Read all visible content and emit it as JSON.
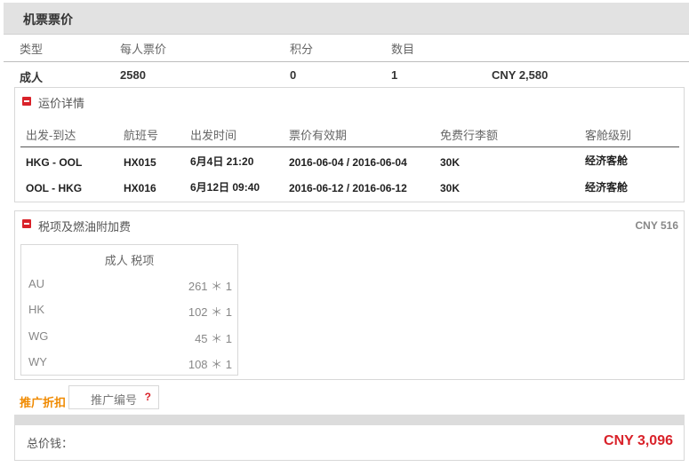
{
  "title": "机票票价",
  "summary": {
    "headers": [
      "类型",
      "每人票价",
      "积分",
      "数目"
    ],
    "row": {
      "type": "成人",
      "price": "2580",
      "points": "0",
      "count": "1",
      "amount": "CNY 2,580"
    }
  },
  "fare_details": {
    "title": "运价详情",
    "headers": [
      "出发-到达",
      "航班号",
      "出发时间",
      "票价有效期",
      "免费行李额",
      "客舱级别"
    ],
    "rows": [
      {
        "route": "HKG - OOL",
        "flight": "HX015",
        "time": "6月4日 21:20",
        "validity": "2016-06-04 / 2016-06-04",
        "baggage": "30K",
        "cabin": "经济客舱"
      },
      {
        "route": "OOL - HKG",
        "flight": "HX016",
        "time": "6月12日 09:40",
        "validity": "2016-06-12 / 2016-06-12",
        "baggage": "30K",
        "cabin": "经济客舱"
      }
    ]
  },
  "taxes": {
    "title": "税项及燃油附加费",
    "total": "CNY 516",
    "box_title": "成人 税项",
    "items": [
      {
        "code": "AU",
        "value": "261 ＊ 1"
      },
      {
        "code": "HK",
        "value": "102 ＊ 1"
      },
      {
        "code": "WG",
        "value": "45 ＊ 1"
      },
      {
        "code": "WY",
        "value": "108 ＊ 1"
      }
    ]
  },
  "promo": {
    "label": "推广折扣",
    "placeholder": "推广编号",
    "help": "?"
  },
  "total": {
    "label": "总价钱：",
    "value": "CNY 3,096"
  },
  "colors": {
    "accent_red": "#d9222a",
    "promo_orange": "#f08a00",
    "header_gray": "#e2e2e2"
  }
}
